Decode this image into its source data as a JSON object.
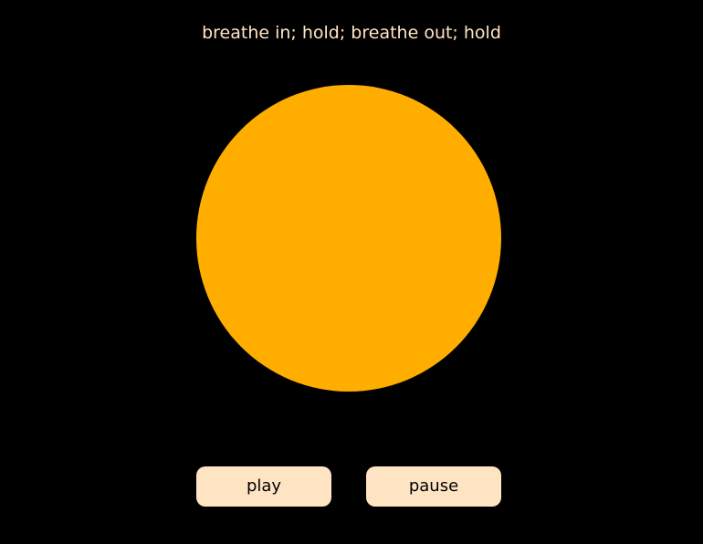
{
  "instruction": {
    "text": "breathe in; hold; breathe out; hold"
  },
  "breath_circle": {
    "color": "#FFAE00"
  },
  "controls": {
    "play_label": "play",
    "pause_label": "pause",
    "button_color": "#FFE4C4"
  },
  "theme": {
    "background": "#000000",
    "text_color": "#FFE4C4"
  }
}
